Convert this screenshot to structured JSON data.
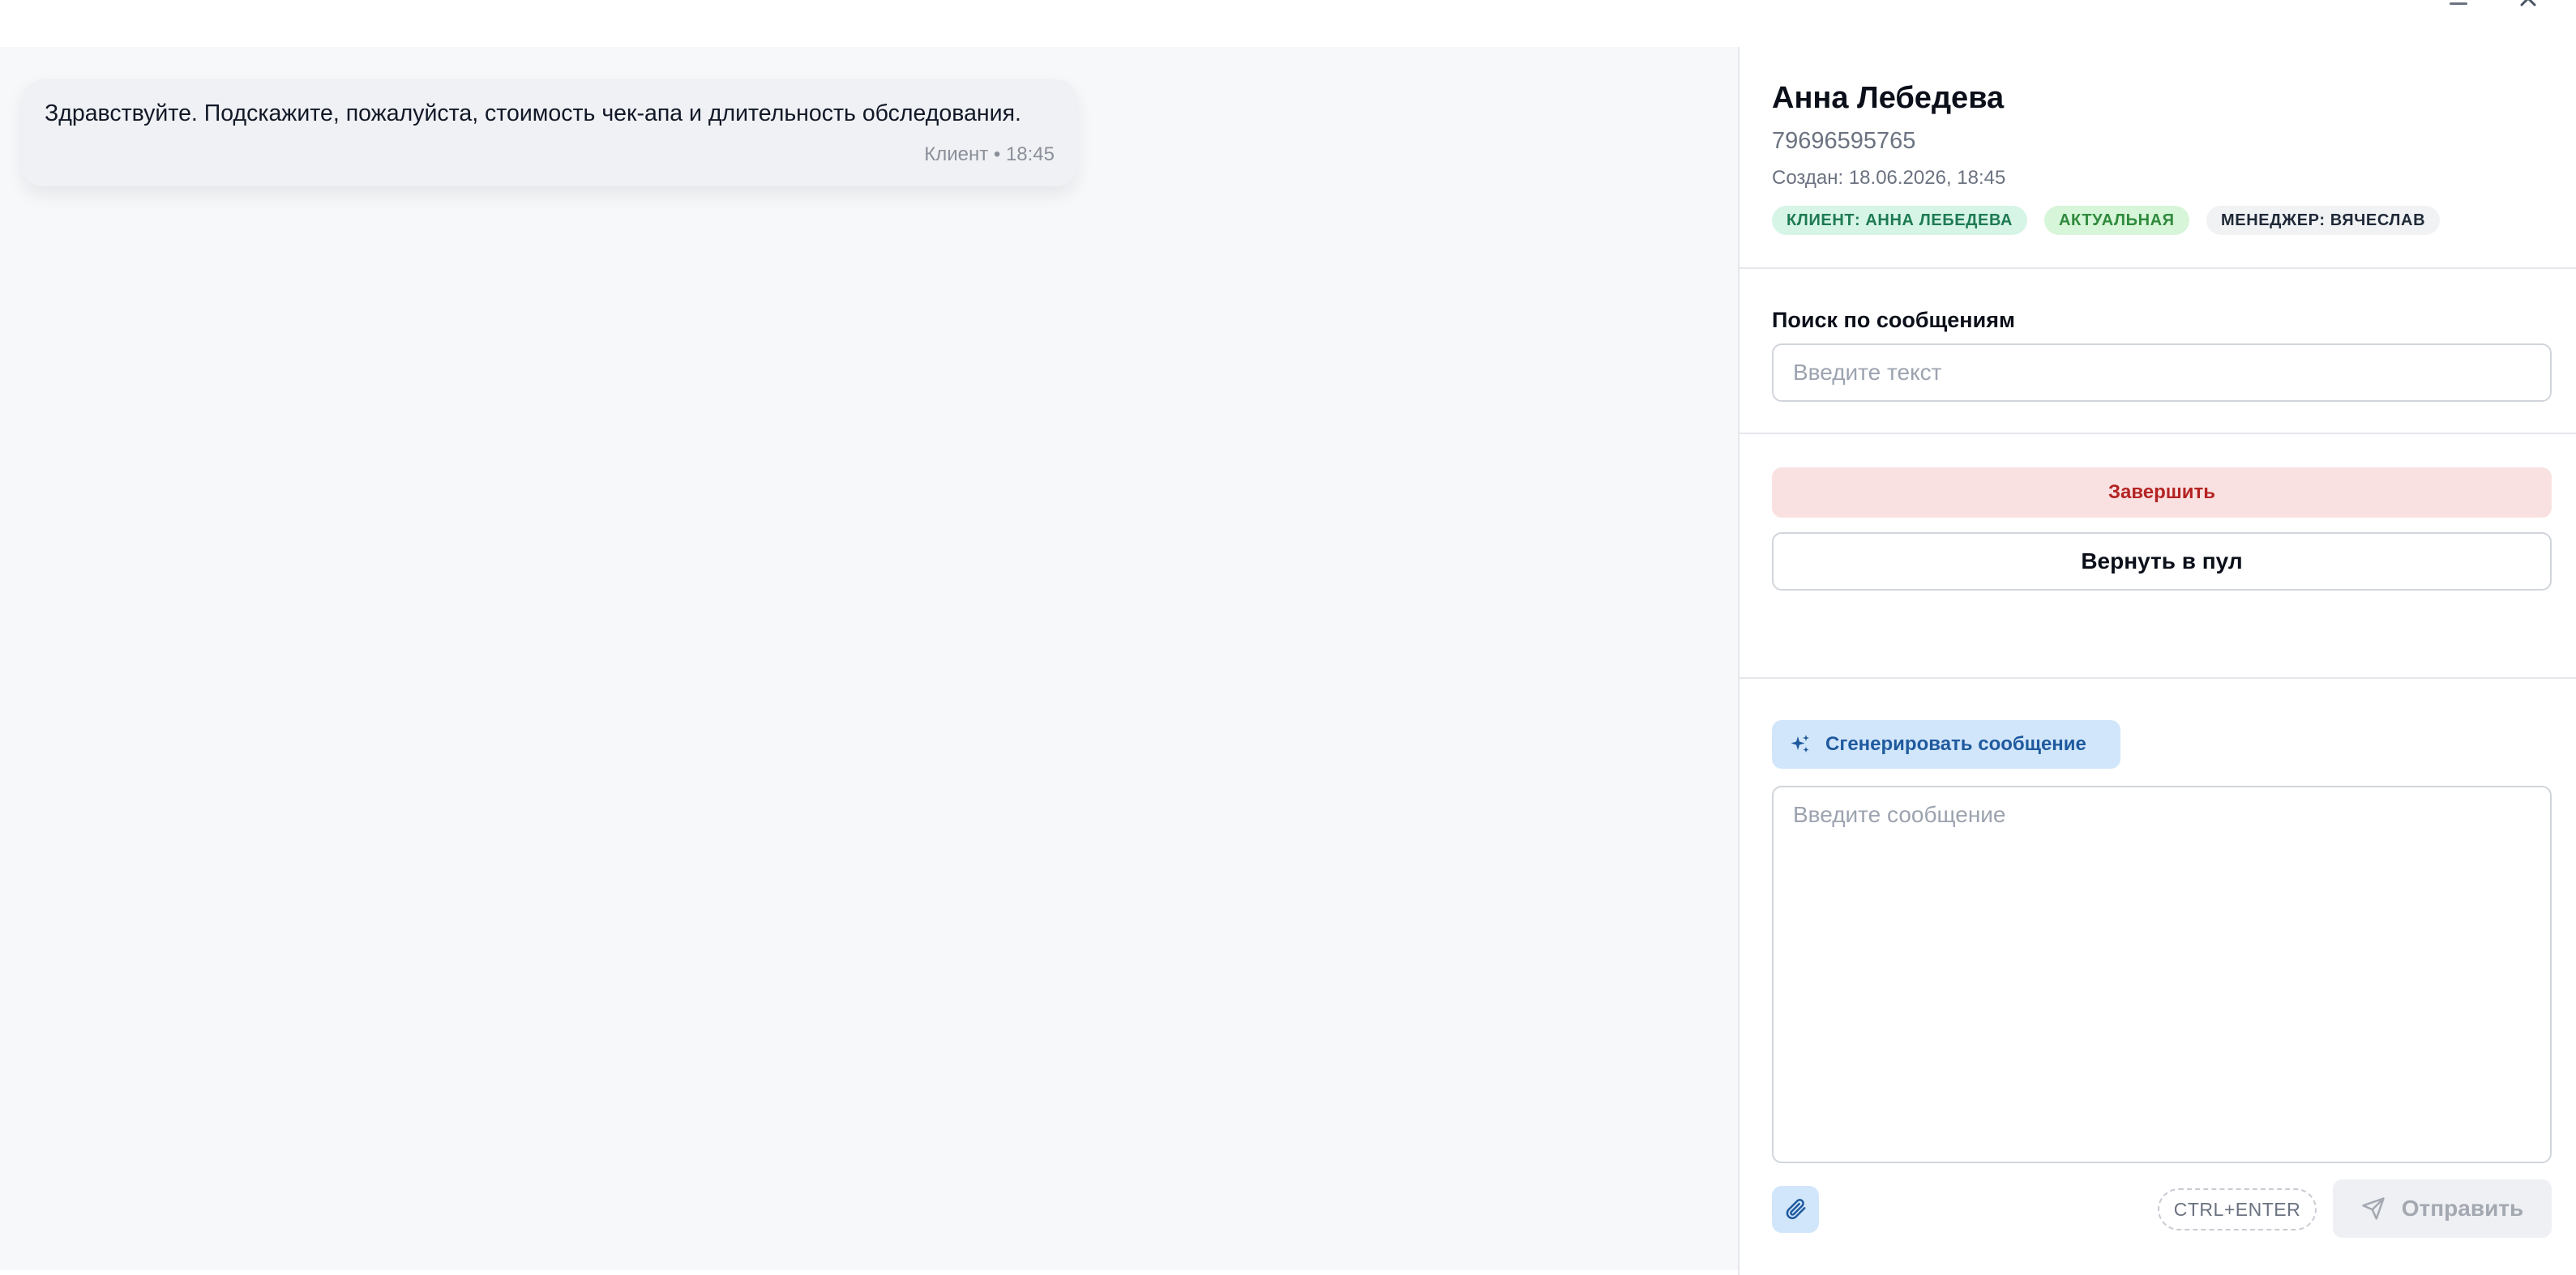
{
  "window": {
    "minimize_icon": "minimize-icon",
    "close_icon": "close-icon"
  },
  "chat": {
    "messages": [
      {
        "text": "Здравствуйте. Подскажите, пожалуйста, стоимость чек-апа и длительность обследования.",
        "meta": "Клиент • 18:45"
      }
    ]
  },
  "contact": {
    "name": "Анна Лебедева",
    "phone": "79696595765",
    "created": "Создан: 18.06.2026, 18:45",
    "badges": {
      "client": "КЛИЕНТ: АННА ЛЕБЕДЕВА",
      "status": "АКТУАЛЬНАЯ",
      "manager": "МЕНЕДЖЕР: ВЯЧЕСЛАВ"
    }
  },
  "search": {
    "label": "Поиск по сообщениям",
    "value": "",
    "placeholder": "Введите текст"
  },
  "actions": {
    "finish_label": "Завершить",
    "return_label": "Вернуть в пул"
  },
  "composer": {
    "generate_label": "Сгенерировать сообщение",
    "generate_icon": "sparkles-icon",
    "message_value": "",
    "message_placeholder": "Введите сообщение",
    "attach_icon": "paperclip-icon",
    "shortcut_hint": "CTRL+ENTER",
    "send_label": "Отправить",
    "send_icon": "send-icon"
  },
  "colors": {
    "finish_bg": "#fae1e1",
    "finish_text": "#b42323",
    "accent_bg": "#d2e6fb",
    "accent_text": "#1f5a9e",
    "badge_client_bg": "#d6f5e7",
    "badge_status_bg": "#d7f5d9",
    "badge_manager_bg": "#f1f2f4"
  }
}
